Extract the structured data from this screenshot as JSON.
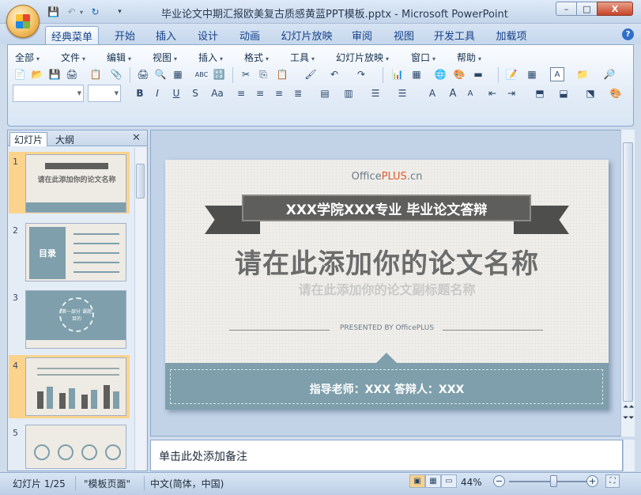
{
  "window": {
    "title": "毕业论文中期汇报欧美复古质感黄蓝PPT模板.pptx - Microsoft PowerPoint",
    "min_symbol": "–",
    "max_symbol": "□",
    "close_symbol": "X"
  },
  "quick_access": {
    "save": "💾",
    "undo": "↶",
    "undo_dd": "▾",
    "redo": "↻",
    "customize": "▾"
  },
  "ribbon_tabs": [
    "经典菜单",
    "开始",
    "插入",
    "设计",
    "动画",
    "幻灯片放映",
    "审阅",
    "视图",
    "开发工具",
    "加载项"
  ],
  "active_tab": 0,
  "help": "?",
  "classic_menus": [
    "全部",
    "文件",
    "编辑",
    "视图",
    "插入",
    "格式",
    "工具",
    "幻灯片放映",
    "窗口",
    "帮助"
  ],
  "classic_menu_arrow": "▾",
  "toolbar_row1": [
    "📄",
    "📂",
    "💾",
    "🖨",
    "📋",
    "📎",
    "🖨",
    "🔍",
    "▦",
    "ABC",
    "🔡",
    "✂",
    "⎘",
    "📋",
    "🖌",
    "↶",
    "↷",
    "📊",
    "▦",
    "🌐",
    "🎨",
    "▬",
    "📝",
    "▦",
    "A",
    "📁",
    "🔎"
  ],
  "toolbar_row2": [
    "B",
    "I",
    "U",
    "S",
    "Aa",
    "≡",
    "≡",
    "≡",
    "≣",
    "▤",
    "▥",
    "☰",
    "☰",
    "A",
    "A",
    "A",
    "⇤",
    "⇥",
    "⬒",
    "⬓",
    "⬔",
    "🎨"
  ],
  "slides_panel": {
    "tab_slides": "幻灯片",
    "tab_outline": "大纲",
    "close": "✕",
    "thumbnails": [
      {
        "number": "1",
        "selected": true,
        "text": "请在此添加你的论文名称"
      },
      {
        "number": "2",
        "selected": false,
        "text": "目录"
      },
      {
        "number": "3",
        "selected": false,
        "text": "第一部分 课题目的"
      },
      {
        "number": "4",
        "selected": true,
        "text": ""
      },
      {
        "number": "5",
        "selected": false,
        "text": ""
      }
    ]
  },
  "slide": {
    "brand_prefix": "Office",
    "brand_highlight": "PLUS",
    "brand_suffix": ".cn",
    "banner": "XXX学院XXX专业 毕业论文答辩",
    "title": "请在此添加你的论文名称",
    "subtitle": "请在此添加你的论文副标题名称",
    "presented": "PRESENTED BY OfficePLUS",
    "advisor": "指导老师：XXX  答辩人：XXX",
    "colors": {
      "banner": "#5e5e5c",
      "footer": "#7e9fab",
      "title": "#6b6c6c",
      "accent": "#e05a2b"
    }
  },
  "notes_placeholder": "单击此处添加备注",
  "nav": {
    "prev": "⏶⏶",
    "next": "⏷⏷"
  },
  "status": {
    "slide_info": "幻灯片 1/25",
    "theme": "\"模板页面\"",
    "language": "中文(简体，中国)",
    "zoom": "44%",
    "zoom_fraction": 0.44,
    "view_normal": "▣",
    "view_sorter": "▦",
    "view_show": "▭",
    "zoom_out": "−",
    "zoom_in": "+",
    "fit": "⛶"
  }
}
